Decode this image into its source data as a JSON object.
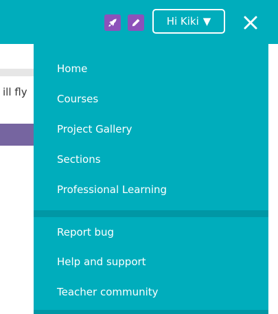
{
  "header": {
    "background": "#00adbc",
    "icons": [
      {
        "name": "rocket-icon",
        "color": "#8c52ba"
      },
      {
        "name": "pencil-icon",
        "color": "#8c52ba"
      }
    ],
    "user_button_label": "Hi Kiki",
    "caret": "▼",
    "close_icon": "close-icon"
  },
  "page": {
    "partial_text": "ill fly"
  },
  "dropdown": {
    "background": "#00adbc",
    "divider_color": "#0097a5",
    "items": [
      {
        "label": "Home"
      },
      {
        "label": "Courses"
      },
      {
        "label": "Project Gallery"
      },
      {
        "label": "Sections"
      },
      {
        "label": "Professional Learning"
      },
      {
        "label": "Report bug"
      },
      {
        "label": "Help and support"
      },
      {
        "label": "Teacher community"
      }
    ]
  }
}
